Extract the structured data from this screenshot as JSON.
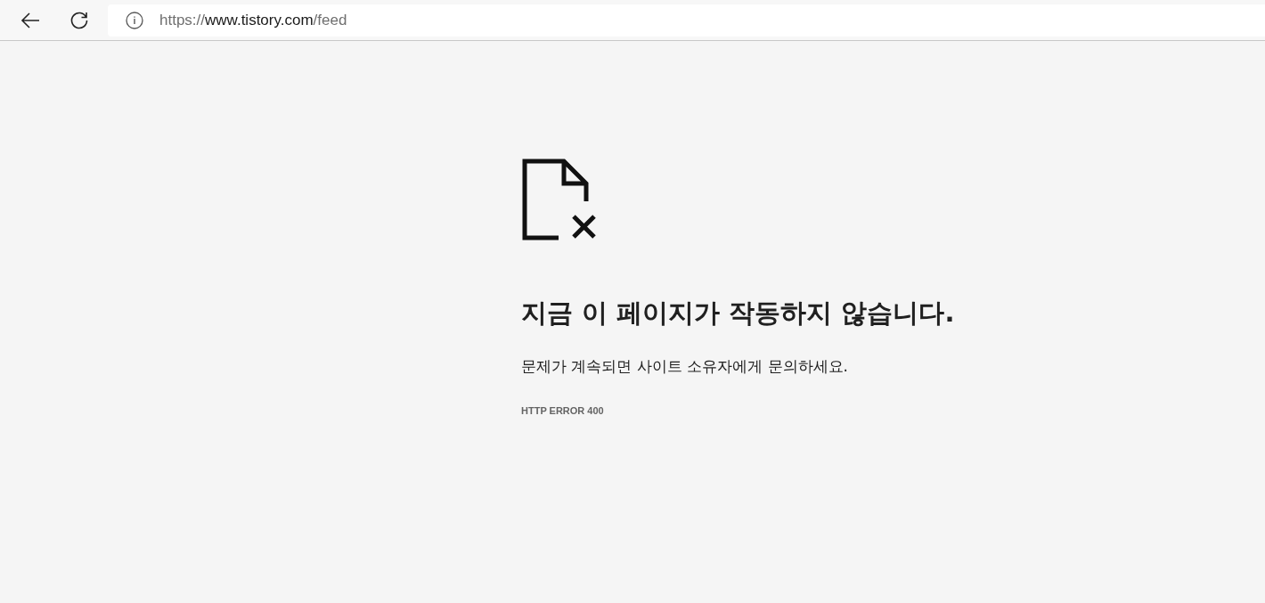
{
  "toolbar": {
    "url": {
      "scheme": "https://",
      "host": "www.tistory.com",
      "path": "/feed"
    }
  },
  "error": {
    "title": "지금 이 페이지가 작동하지 않습니다.",
    "message": "문제가 계속되면 사이트 소유자에게 문의하세요.",
    "code": "HTTP ERROR 400"
  }
}
